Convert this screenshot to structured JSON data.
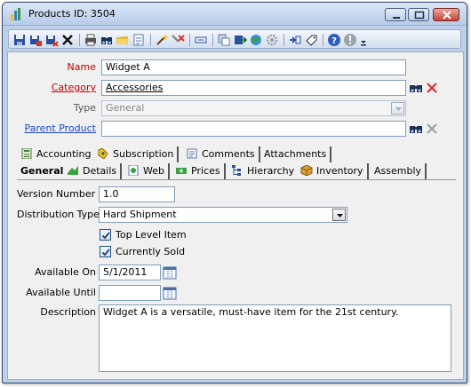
{
  "window": {
    "title": "Products ID: 3504"
  },
  "toolbar": {
    "icons": [
      "save-icon",
      "save-new-icon",
      "save-close-icon",
      "delete-icon",
      "print-icon",
      "find-icon",
      "open-folder-icon",
      "notes-icon",
      "wand-icon",
      "tools-icon",
      "link-icon",
      "copy-icon",
      "export-icon",
      "web-icon",
      "settings-icon",
      "attach-icon",
      "tag-icon",
      "help-icon",
      "info-icon",
      "overflow-icon"
    ]
  },
  "form": {
    "name": {
      "label": "Name",
      "value": "Widget A"
    },
    "category": {
      "label": "Category",
      "value": "Accessories"
    },
    "type": {
      "label": "Type",
      "value": "General"
    },
    "parent_product": {
      "label": "Parent Product",
      "value": ""
    }
  },
  "tabs": {
    "row1": [
      {
        "label": "Accounting",
        "icon": "calculator-icon"
      },
      {
        "label": "Subscription",
        "icon": "subscription-icon"
      },
      {
        "label": "Comments",
        "icon": "comments-icon"
      },
      {
        "label": "Attachments",
        "icon": ""
      }
    ],
    "row2": [
      {
        "label": "General",
        "active": true
      },
      {
        "label": "Details",
        "icon": "details-icon"
      },
      {
        "label": "Web",
        "icon": "web-page-icon"
      },
      {
        "label": "Prices",
        "icon": "prices-icon"
      },
      {
        "label": "Hierarchy",
        "icon": "hierarchy-icon"
      },
      {
        "label": "Inventory",
        "icon": "inventory-icon"
      },
      {
        "label": "Assembly",
        "icon": ""
      }
    ]
  },
  "general": {
    "version_number": {
      "label": "Version Number",
      "value": "1.0"
    },
    "distribution_type": {
      "label": "Distribution Type",
      "value": "Hard Shipment"
    },
    "top_level_item": {
      "label": "Top Level Item",
      "checked": true
    },
    "currently_sold": {
      "label": "Currently Sold",
      "checked": true
    },
    "available_on": {
      "label": "Available On",
      "value": "5/1/2011"
    },
    "available_until": {
      "label": "Available Until",
      "value": ""
    },
    "description": {
      "label": "Description",
      "value": "Widget A is a versatile, must-have item for the 21st century."
    }
  },
  "colors": {
    "required_label": "#c00000",
    "link_label": "#1f45c4",
    "window_frame": "#bcd0ea"
  }
}
